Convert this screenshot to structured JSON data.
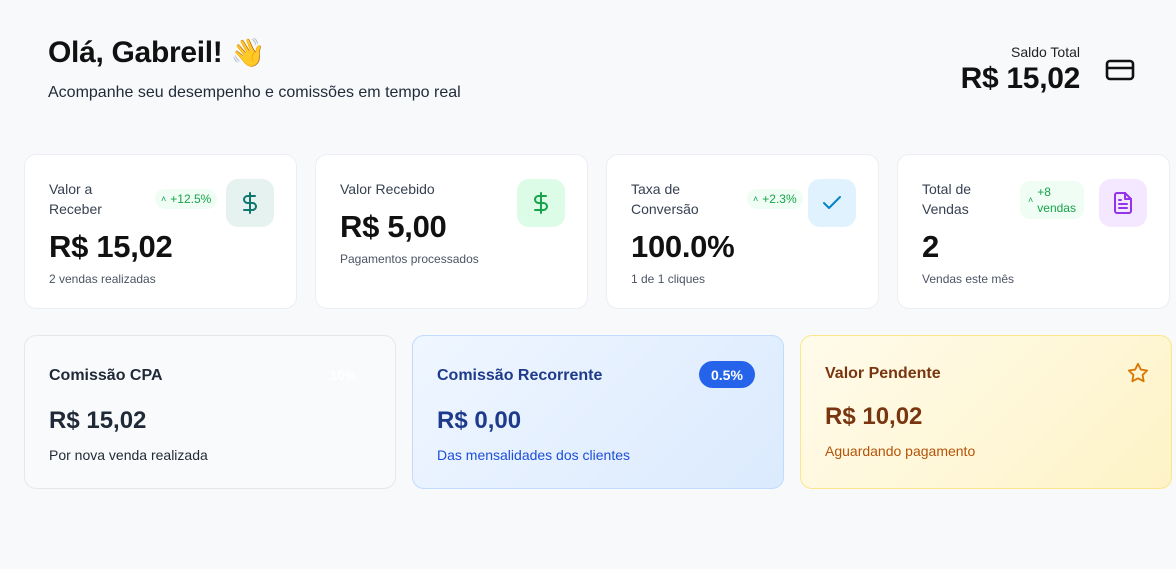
{
  "header": {
    "greeting": "Olá, Gabreil!",
    "wave_emoji": "👋",
    "subtitle": "Acompanhe seu desempenho e comissões em tempo real"
  },
  "balance": {
    "label": "Saldo Total",
    "value": "R$ 15,02",
    "icon": "credit-card-icon"
  },
  "stats": [
    {
      "title": "Valor a Receber",
      "value": "R$ 15,02",
      "note": "2 vendas realizadas",
      "badge": "+12.5%",
      "icon": "dollar-icon",
      "color": "#16a34a"
    },
    {
      "title": "Valor Recebido",
      "value": "R$ 5,00",
      "note": "Pagamentos processados",
      "icon": "dollar-icon",
      "color": "#16a34a"
    },
    {
      "title": "Taxa de Conversão",
      "value": "100.0%",
      "note": "1 de 1 cliques",
      "badge": "+2.3%",
      "icon": "check-icon",
      "color": "#0284c7"
    },
    {
      "title": "Total de Vendas",
      "value": "2",
      "note": "Vendas este mês",
      "badge_line1": "+8",
      "badge_line2": "vendas",
      "icon": "document-icon",
      "color": "#9333ea"
    }
  ],
  "commissions": [
    {
      "title": "Comissão CPA",
      "value": "R$ 15,02",
      "note": "Por nova venda realizada",
      "badge": "10%"
    },
    {
      "title": "Comissão Recorrente",
      "value": "R$ 0,00",
      "note": "Das mensalidades dos clientes",
      "badge": "0.5%"
    },
    {
      "title": "Valor Pendente",
      "value": "R$ 10,02",
      "note": "Aguardando pagamento",
      "icon": "star-icon"
    }
  ]
}
